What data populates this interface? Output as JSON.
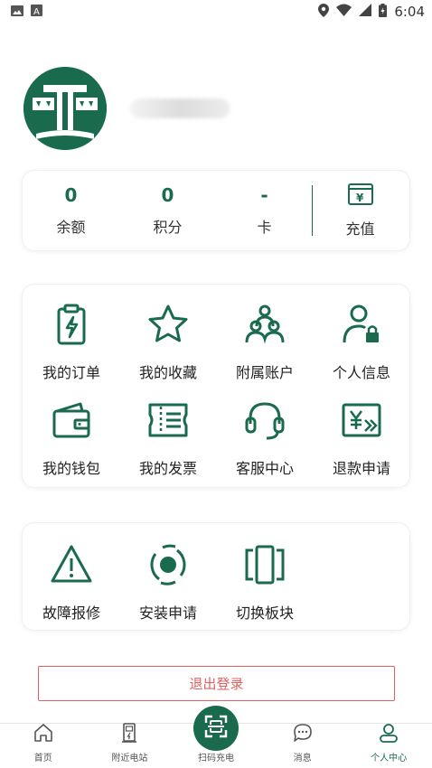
{
  "status_bar": {
    "time": "6:04",
    "icons": [
      "image-icon",
      "text-icon",
      "location-icon",
      "wifi-icon",
      "signal-icon",
      "battery-icon"
    ]
  },
  "profile": {
    "avatar": "logo-avatar",
    "name_blurred": true
  },
  "stats": {
    "items": [
      {
        "value": "0",
        "label": "余额"
      },
      {
        "value": "0",
        "label": "积分"
      },
      {
        "value": "-",
        "label": "卡"
      }
    ],
    "recharge_label": "充值"
  },
  "services": [
    {
      "label": "我的订单",
      "icon": "order-icon"
    },
    {
      "label": "我的收藏",
      "icon": "star-icon"
    },
    {
      "label": "附属账户",
      "icon": "group-icon"
    },
    {
      "label": "个人信息",
      "icon": "user-lock-icon"
    },
    {
      "label": "我的钱包",
      "icon": "wallet-icon"
    },
    {
      "label": "我的发票",
      "icon": "invoice-icon"
    },
    {
      "label": "客服中心",
      "icon": "headset-icon"
    },
    {
      "label": "退款申请",
      "icon": "refund-icon"
    }
  ],
  "tools": [
    {
      "label": "故障报修",
      "icon": "warning-icon"
    },
    {
      "label": "安装申请",
      "icon": "install-icon"
    },
    {
      "label": "切换板块",
      "icon": "switch-icon"
    }
  ],
  "logout_label": "退出登录",
  "tabbar": {
    "tabs": [
      {
        "label": "首页",
        "icon": "home-icon"
      },
      {
        "label": "附近电站",
        "icon": "station-icon"
      },
      {
        "label": "扫码充电",
        "icon": "scan-icon"
      },
      {
        "label": "消息",
        "icon": "message-icon"
      },
      {
        "label": "个人中心",
        "icon": "user-icon"
      }
    ],
    "active_index": 4
  },
  "colors": {
    "primary": "#1a6b4e",
    "danger": "#e06060"
  }
}
